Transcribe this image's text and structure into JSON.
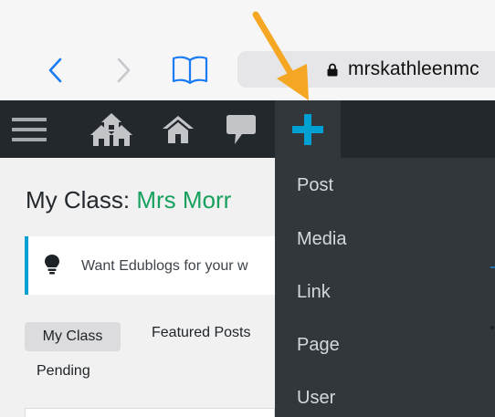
{
  "browser": {
    "url": "mrskathleenmc",
    "colors": {
      "nav_arrow": "#1a7cf5",
      "nav_disabled": "#c7c7cc"
    },
    "icons": [
      "back-chevron-icon",
      "forward-chevron-icon",
      "book-icon",
      "lock-icon"
    ]
  },
  "admin_bar": {
    "icons": [
      "menu-icon",
      "my-sites-icon",
      "home-icon",
      "comment-icon",
      "plus-icon"
    ],
    "colors": {
      "background": "#23282d",
      "plus": "#00a0d2"
    }
  },
  "new_menu": {
    "items": [
      {
        "label": "Post"
      },
      {
        "label": "Media"
      },
      {
        "label": "Link"
      },
      {
        "label": "Page"
      },
      {
        "label": "User"
      }
    ]
  },
  "dashboard": {
    "title_prefix": "My Class: ",
    "title_name": "Mrs Morr",
    "notice_text": "Want Edublogs for your w",
    "tabs": [
      {
        "label": "My Class",
        "active": true
      },
      {
        "label": "Featured Posts",
        "active": false
      },
      {
        "label": "Pending",
        "active": false
      }
    ]
  },
  "annotation": {
    "icon": "arrow-down-right-icon",
    "color": "#f5a623"
  }
}
